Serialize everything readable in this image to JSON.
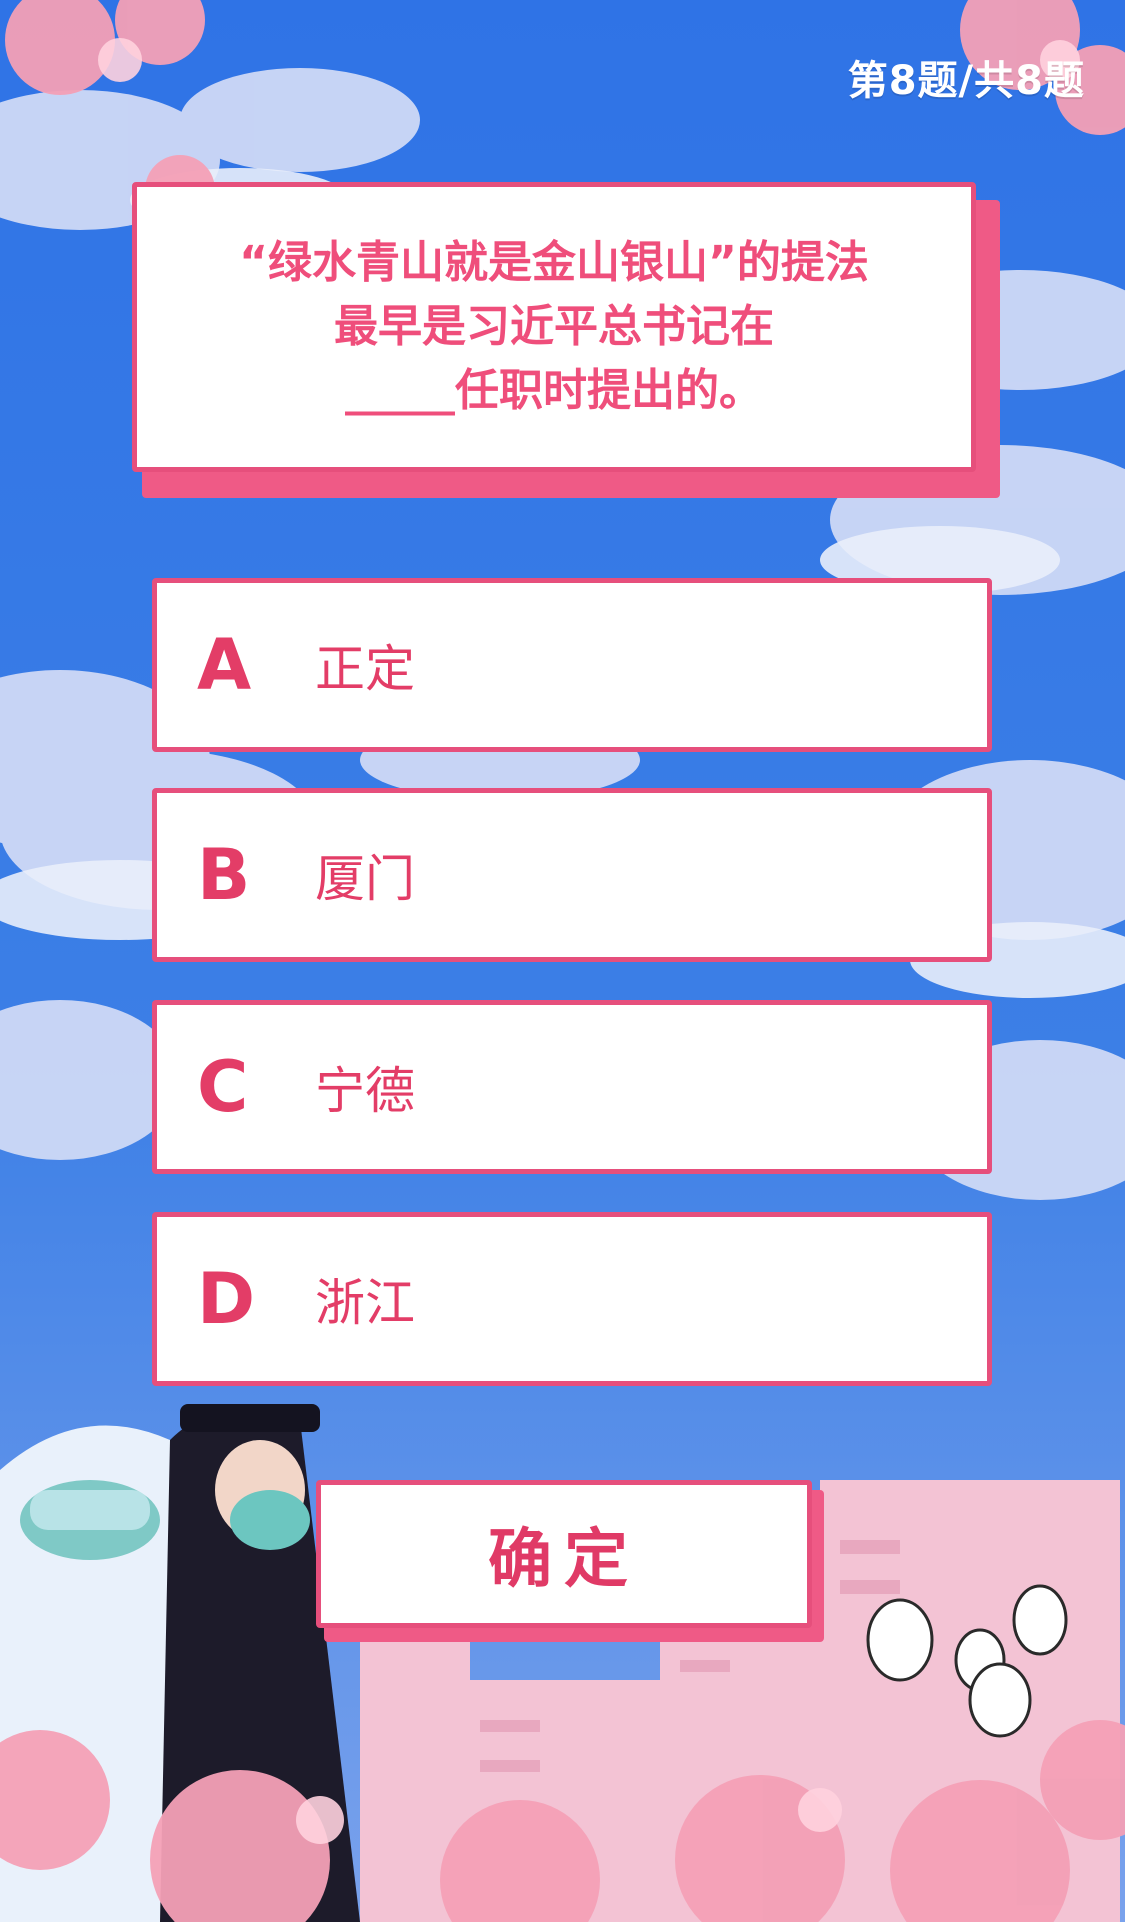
{
  "progress": "第8题/共8题",
  "question": "“绿水青山就是金山银山”的提法\n最早是习近平总书记在\n_____任职时提出的。",
  "options": [
    {
      "letter": "A",
      "text": "正定"
    },
    {
      "letter": "B",
      "text": "厦门"
    },
    {
      "letter": "C",
      "text": "宁德"
    },
    {
      "letter": "D",
      "text": "浙江"
    }
  ],
  "confirm": "确定",
  "colors": {
    "accent": "#e64f7c",
    "accent_text": "#e33d67",
    "sky": "#3f7fe0",
    "cloud": "#c9d5f5",
    "petal": "#f4a0b6"
  }
}
